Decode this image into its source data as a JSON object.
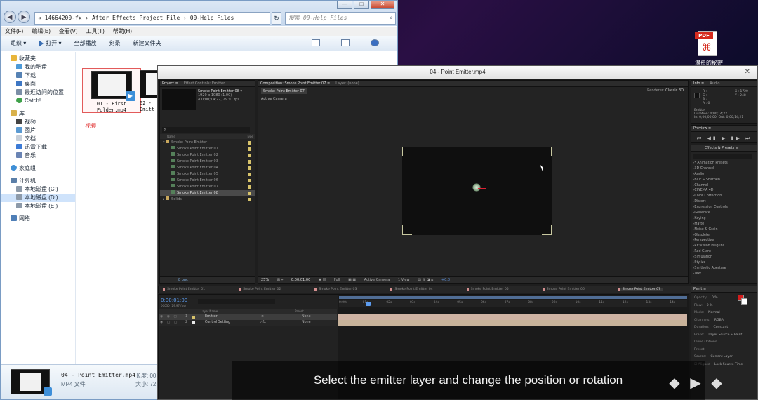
{
  "explorer": {
    "address": "« 14664200-fx › After Effects Project File › 00-Help Files",
    "search_placeholder": "搜索 00-Help Files",
    "menu": [
      "文件(F)",
      "编辑(E)",
      "查看(V)",
      "工具(T)",
      "帮助(H)"
    ],
    "toolbar": {
      "organize": "组织 ▾",
      "open": "打开 ▾",
      "play_all": "全部播放",
      "burn": "刻录",
      "new_folder": "新建文件夹"
    },
    "sidebar": {
      "favorites": "收藏夹",
      "fav_items": [
        "我的酷盘",
        "下载",
        "桌面",
        "最近访问的位置",
        "Catch!"
      ],
      "libraries": "库",
      "lib_items": [
        "视频",
        "图片",
        "文档",
        "迅雷下载",
        "音乐"
      ],
      "homegroup": "家庭组",
      "computer": "计算机",
      "drives": [
        "本地磁盘 (C:)",
        "本地磁盘 (D:)",
        "本地磁盘 (E:)"
      ],
      "network": "网络"
    },
    "files": [
      {
        "label1": "01 - First",
        "label2": "Folder.mp4"
      },
      {
        "label1": "02 -",
        "label2": "Emitt"
      }
    ],
    "group_label": "视频",
    "status": {
      "name": "04 - Point Emitter.mp4",
      "type": "MP4 文件",
      "k1": "长度: 00",
      "k2": "大小: 72"
    }
  },
  "desktop": {
    "pdf_tag": "PDF",
    "pdf_label": "浪费的秘密"
  },
  "ae": {
    "title": "04 - Point Emitter.mp4",
    "project_tabs": [
      "Project ≡",
      "Effect Controls: Emitter"
    ],
    "project_meta": {
      "name": "Smoke Point Emitter 08 ▾",
      "line1": "1920 x 1080 (1.00)",
      "line2": "Δ 0;00;14;22, 29.97 fps"
    },
    "project_head": {
      "name": "Name",
      "type": "Type"
    },
    "project_items": [
      {
        "name": "Smoke Point Emitter",
        "child": false,
        "sel": false
      },
      {
        "name": "Smoke Point Emitter 01",
        "child": true,
        "sel": false
      },
      {
        "name": "Smoke Point Emitter 02",
        "child": true,
        "sel": false
      },
      {
        "name": "Smoke Point Emitter 03",
        "child": true,
        "sel": false
      },
      {
        "name": "Smoke Point Emitter 04",
        "child": true,
        "sel": false
      },
      {
        "name": "Smoke Point Emitter 05",
        "child": true,
        "sel": false
      },
      {
        "name": "Smoke Point Emitter 06",
        "child": true,
        "sel": false
      },
      {
        "name": "Smoke Point Emitter 07",
        "child": true,
        "sel": false
      },
      {
        "name": "Smoke Point Emitter 08",
        "child": true,
        "sel": true
      },
      {
        "name": "Solids",
        "child": false,
        "sel": false
      }
    ],
    "project_foot": "8 bpc",
    "comp_tabs": [
      "Composition: Smoke Point Emitter 07 ≡",
      "Layer: (none)"
    ],
    "comp_subtab": "Smoke Point Emitter 07",
    "renderer_label": "Renderer:",
    "renderer_value": "Classic 3D",
    "active_camera": "Active Camera",
    "comp_bar": {
      "zoom": "25%",
      "timecode": "0;00;01;00",
      "res": "Full",
      "view": "Active Camera",
      "views": "1 View",
      "exposure": "+0.0"
    },
    "info_tabs": [
      "Info ≡",
      "Audio"
    ],
    "info": {
      "r": "R :",
      "g": "G :",
      "b": "B :",
      "a": "A : 0",
      "x": "X : 1720",
      "y": "Y : 248"
    },
    "info_layer": [
      "Emitter",
      "Duration: 0;00;14;22",
      "In: 0;00;00;00, Out: 0;00;14;21"
    ],
    "preview_tab": "Preview ≡",
    "preview_buttons": "⏮ ◀▮ ▶ ▮▶ ⏭",
    "fx_tabs": [
      "Effects & Presets ≡"
    ],
    "fx_items": [
      "* Animation Presets",
      "3D Channel",
      "Audio",
      "Blur & Sharpen",
      "Channel",
      "CINEMA 4D",
      "Color Correction",
      "Distort",
      "Expression Controls",
      "Generate",
      "Keying",
      "Matte",
      "Noise & Grain",
      "Obsolete",
      "Perspective",
      "RE:Vision Plug-ins",
      "Red Giant",
      "Simulation",
      "Stylize",
      "Synthetic Aperture",
      "Text"
    ],
    "tl_tabs": [
      {
        "label": "Smoke Point Emitter 01",
        "act": false
      },
      {
        "label": "Smoke Point Emitter 02",
        "act": false
      },
      {
        "label": "Smoke Point Emitter 03",
        "act": false
      },
      {
        "label": "Smoke Point Emitter 04",
        "act": false
      },
      {
        "label": "Smoke Point Emitter 05",
        "act": false
      },
      {
        "label": "Smoke Point Emitter 06",
        "act": false
      },
      {
        "label": "Smoke Point Emitter 07",
        "act": true
      },
      {
        "label": "Smoke Point Emitter 08",
        "act": false
      }
    ],
    "timecode": "0;00;01;00",
    "fps": "00030 (29.97 fps)",
    "tl_head": {
      "name": "Layer Name",
      "parent": "Parent"
    },
    "layers": [
      {
        "num": "1",
        "name": "Emitter",
        "parent": "None",
        "color": "#d6c16a"
      },
      {
        "num": "2",
        "name": "Control Setting",
        "parent": "None",
        "color": "#e8e8e8"
      }
    ],
    "ruler": [
      "0:00s",
      "01s",
      "02s",
      "03s",
      "04s",
      "05s",
      "06s",
      "07s",
      "08s",
      "09s",
      "10s",
      "11s",
      "12s",
      "13s",
      "14s"
    ],
    "paint": {
      "tab": "Paint ≡",
      "rows": [
        {
          "k": "Opacity:",
          "v": "0 %"
        },
        {
          "k": "Flow:",
          "v": "0 %"
        },
        {
          "k": "Mode:",
          "v": "Normal"
        },
        {
          "k": "Channels:",
          "v": "RGBA"
        },
        {
          "k": "Duration:",
          "v": "Constant"
        },
        {
          "k": "Erase:",
          "v": "Layer Source & Paint"
        },
        {
          "k": "Clone Options",
          "v": ""
        },
        {
          "k": "Preset:",
          "v": ""
        },
        {
          "k": "Source:",
          "v": "Current Layer"
        },
        {
          "k": "☑ Aligned",
          "v": "Lock Source Time"
        }
      ]
    }
  },
  "subtitle": "Select the emitter layer and change the position or rotation",
  "badges": [
    "◆",
    "▶",
    "◆"
  ]
}
